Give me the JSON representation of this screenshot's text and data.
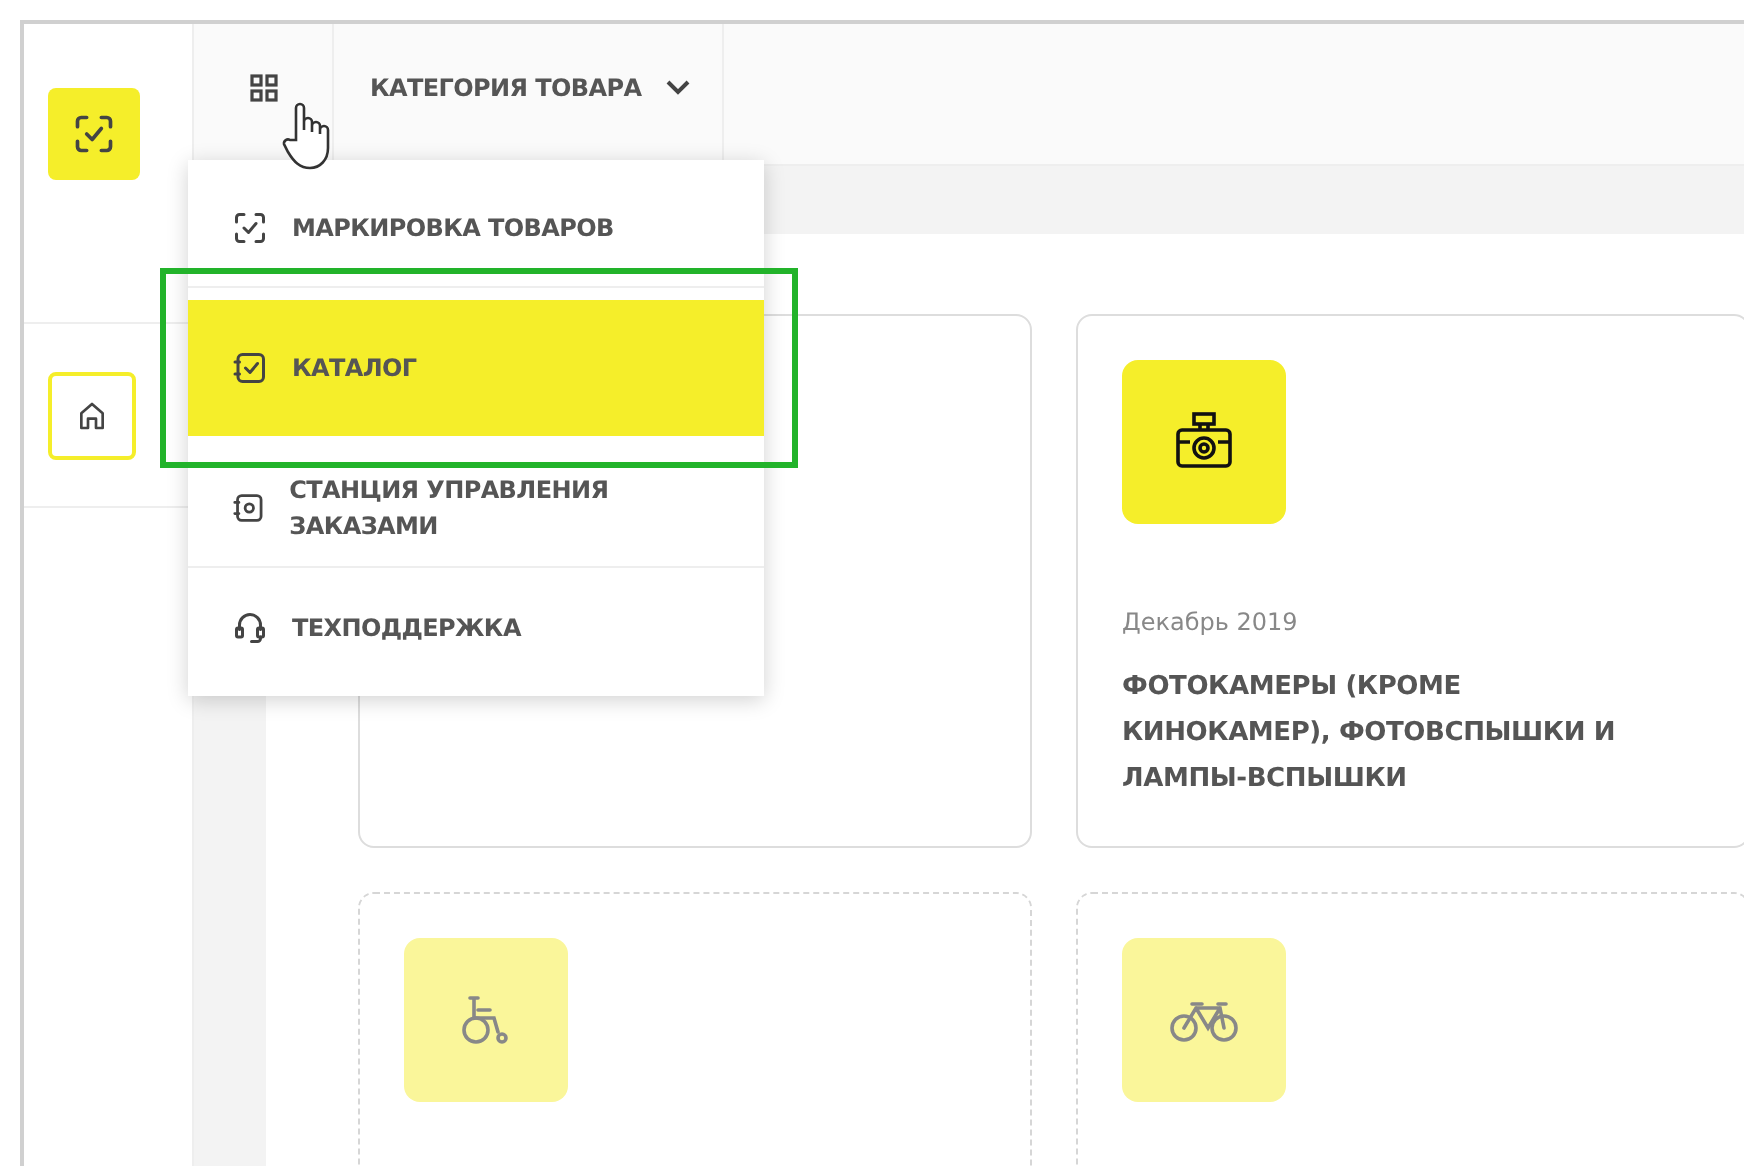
{
  "top_bar": {
    "category_label": "КАТЕГОРИЯ ТОВАРА"
  },
  "menu": [
    {
      "label": "МАРКИРОВКА ТОВАРОВ",
      "selected": false
    },
    {
      "label": "КАТАЛОГ",
      "selected": true
    },
    {
      "label": "СТАНЦИЯ УПРАВЛЕНИЯ ЗАКАЗАМИ",
      "selected": false
    },
    {
      "label": "ТЕХПОДДЕРЖКА",
      "selected": false
    }
  ],
  "cards": [
    {
      "available": true
    },
    {
      "date": "Декабрь 2019",
      "title": "ФОТОКАМЕРЫ (КРОМЕ КИНОКАМЕР), ФОТОВСПЫШКИ И ЛАМПЫ-ВСПЫШКИ",
      "available": true
    },
    {
      "available": false
    },
    {
      "available": false
    }
  ]
}
